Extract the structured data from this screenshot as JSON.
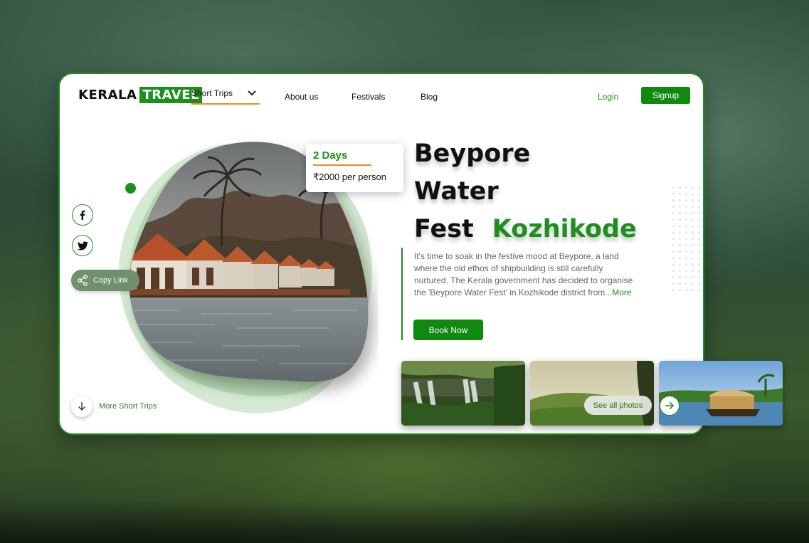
{
  "brand": {
    "part1": "KERALA",
    "part2": "TRAVEL"
  },
  "nav": {
    "dropdown_label": "Short Trips",
    "links": [
      "About us",
      "Festivals",
      "Blog"
    ],
    "login": "Login",
    "signup": "Signup"
  },
  "offer": {
    "duration": "2 Days",
    "price": "₹2000 per person"
  },
  "hero": {
    "title_line1": "Beypore",
    "title_line2": "Water",
    "title_line3": "Fest",
    "title_accent": "Kozhikode",
    "description": "It's time to soak in the festive mood at Beypore, a land where the old ethos of shipbuilding is still carefully nurtured. The Kerala government has decided to organise the 'Beypore Water Fest' in Kozhikode district from",
    "more_link": "...More",
    "cta": "Book Now"
  },
  "share": {
    "copy_link": "Copy Link"
  },
  "footer": {
    "more_trips": "More Short Trips",
    "see_all": "See all photos"
  },
  "icons": [
    "chevron-down-icon",
    "facebook-icon",
    "twitter-icon",
    "share-icon",
    "arrow-down-icon",
    "arrow-right-icon"
  ],
  "colors": {
    "brand_green": "#1d8f1d",
    "button_green": "#0f8a0f",
    "accent_orange": "#f08a24"
  }
}
